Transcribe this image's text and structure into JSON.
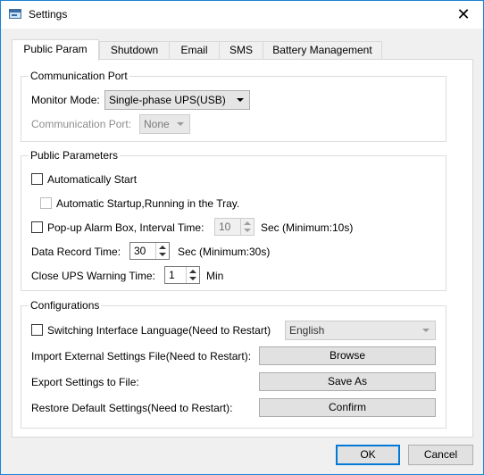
{
  "window": {
    "title": "Settings"
  },
  "tabs": [
    "Public Param",
    "Shutdown",
    "Email",
    "SMS",
    "Battery Management"
  ],
  "communication_port": {
    "group_title": "Communication Port",
    "monitor_mode_label": "Monitor Mode:",
    "monitor_mode_value": "Single-phase UPS(USB)",
    "comm_port_label": "Communication Port:",
    "comm_port_value": "None"
  },
  "public_parameters": {
    "group_title": "Public Parameters",
    "auto_start_label": "Automatically Start",
    "auto_start_checked": false,
    "tray_startup_label": "Automatic Startup,Running in the Tray.",
    "tray_startup_checked": false,
    "popup_alarm_label": "Pop-up Alarm Box, Interval Time:",
    "popup_alarm_checked": false,
    "popup_interval_value": "10",
    "popup_interval_unit": "Sec  (Minimum:10s)",
    "data_record_label": "Data Record Time:",
    "data_record_value": "30",
    "data_record_unit": "Sec  (Minimum:30s)",
    "close_warning_label": "Close UPS Warning Time:",
    "close_warning_value": "1",
    "close_warning_unit": "Min"
  },
  "configurations": {
    "group_title": "Configurations",
    "switch_language_label": "Switching Interface Language(Need to Restart)",
    "switch_language_checked": false,
    "language_value": "English",
    "import_label": "Import External Settings File(Need to Restart):",
    "import_button": "Browse",
    "export_label": "Export Settings to File:",
    "export_button": "Save As",
    "restore_label": "Restore Default Settings(Need to Restart):",
    "restore_button": "Confirm"
  },
  "footer": {
    "ok_label": "OK",
    "cancel_label": "Cancel"
  },
  "colors": {
    "accent": "#0078d7",
    "window_border": "#1883d7"
  }
}
